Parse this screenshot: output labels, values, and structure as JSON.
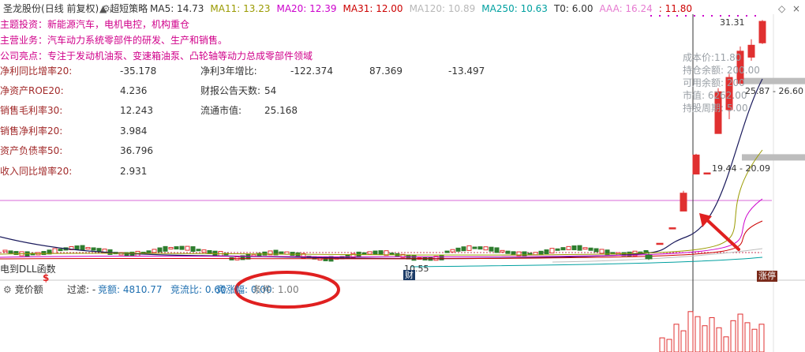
{
  "header": {
    "stock_name": "圣龙股份",
    "period": "(日线 前复权)",
    "strategy": "超短策略",
    "ma": [
      {
        "text": "MA5: 14.73",
        "color": "#333333"
      },
      {
        "text": "MA11: 13.23",
        "color": "#9a9a00"
      },
      {
        "text": "MA20: 12.39",
        "color": "#cc00cc"
      },
      {
        "text": "MA31: 12.00",
        "color": "#cc0000"
      },
      {
        "text": "MA120: 10.89",
        "color": "#b8b8b8"
      },
      {
        "text": "MA250: 10.63",
        "color": "#00a0a0"
      },
      {
        "text": "T0: 6.00",
        "color": "#333333"
      },
      {
        "text": "AAA: 16.24",
        "color": "#e67ad0"
      },
      {
        "text": ": 11.80",
        "color": "#cc0000"
      }
    ]
  },
  "company": {
    "theme": "主题投资：新能源汽车，电机电控，机构重仓",
    "business": "主营业务：汽车动力系统零部件的研发、生产和销售。",
    "highlight": "公司亮点：专注于发动机油泵、变速箱油泵、凸轮轴等动力总成零部件领域"
  },
  "financials": {
    "net_profit_yoy_label": "净利同比增率20:",
    "net_profit_yoy": "-35.178",
    "net_profit_3y_label": "净利3年增比:",
    "net_profit_3y": [
      "-122.374",
      "87.369",
      "-13.497"
    ],
    "roe_label": "净资产ROE20:",
    "roe": "4.236",
    "report_days_label": "财报公告天数:",
    "report_days": "54",
    "gross_margin_label": "销售毛利率30:",
    "gross_margin": "12.243",
    "float_cap_label": "流通市值:",
    "float_cap": "25.168",
    "net_margin_label": "销售净利率20:",
    "net_margin": "3.984",
    "debt_ratio_label": "资产负债率50:",
    "debt_ratio": "36.796",
    "revenue_yoy_label": "收入同比增率20:",
    "revenue_yoy": "2.931"
  },
  "position": {
    "cost": "成本价:11.80",
    "holding": "持仓余额: 200.00",
    "available": "可用余额: 200",
    "market_value": "市值: 6262.00",
    "holding_period": "持股周期: 5.00"
  },
  "chart_data": {
    "type": "candlestick",
    "last_price_label": "31.31",
    "levels": [
      {
        "text": "25.87 - 26.60",
        "value": 26.2
      },
      {
        "text": "19.44 - 20.09",
        "value": 19.8
      }
    ],
    "low_label": "10.55",
    "low_value": 10.55,
    "ylim": [
      10.3,
      31.8
    ],
    "recent_candles": [
      {
        "open": 11.6,
        "close": 11.3,
        "high": 11.9,
        "low": 11.2
      },
      {
        "open": 12.6,
        "close": 12.6,
        "high": 12.6,
        "low": 12.6
      },
      {
        "open": 13.9,
        "close": 13.9,
        "high": 13.9,
        "low": 13.9
      },
      {
        "open": 15.3,
        "close": 16.8,
        "high": 17.0,
        "low": 15.3
      },
      {
        "open": 18.4,
        "close": 20.0,
        "high": 20.1,
        "low": 18.4
      },
      {
        "open": 18.5,
        "close": 18.5,
        "high": 18.5,
        "low": 18.5
      },
      {
        "open": 21.8,
        "close": 25.3,
        "high": 25.6,
        "low": 21.8
      },
      {
        "open": 23.8,
        "close": 26.5,
        "high": 26.8,
        "low": 23.0
      },
      {
        "open": 26.0,
        "close": 28.7,
        "high": 29.1,
        "low": 26.0
      },
      {
        "open": 28.2,
        "close": 29.2,
        "high": 29.7,
        "low": 27.9
      },
      {
        "open": 29.4,
        "close": 31.2,
        "high": 31.31,
        "low": 29.3
      }
    ],
    "volume_bars": [
      0.28,
      0.25,
      0.55,
      0.42,
      0.8,
      0.7,
      0.52,
      0.68,
      0.48,
      0.3,
      0.62,
      0.75,
      0.58,
      0.45,
      0.55
    ]
  },
  "labels": {
    "indicator": "电到DLL函数",
    "cai": "财",
    "limit_up": "涨停",
    "dollar": "$"
  },
  "footer": {
    "title": "竞价额",
    "filter": "过滤: -",
    "amount": "竞额: 4810.77",
    "ratio": "竞流比: 0.60",
    "change": "竞涨幅: 0.00",
    "condition": "条件: 1.00"
  },
  "colors": {
    "up": "#e03030",
    "down": "#2e7d2e",
    "annotation": "#e02020",
    "label_red": "#a22a2a"
  }
}
